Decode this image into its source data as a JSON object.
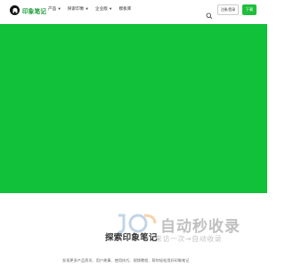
{
  "brand": {
    "name": "印象笔记"
  },
  "nav": {
    "items": [
      {
        "label": "产品",
        "dropdown": true
      },
      {
        "label": "探索印象",
        "dropdown": true
      },
      {
        "label": "企业版",
        "dropdown": true
      },
      {
        "label": "模板库",
        "dropdown": false
      }
    ]
  },
  "header": {
    "search_icon": "search-icon",
    "signup_label": "注册/登录",
    "download_label": "下载"
  },
  "hero": {
    "background": "#12c13a"
  },
  "section": {
    "title": "探索印象笔记",
    "description": "发现更多产品资讯、用户故事、使用技巧、视频教程、帮你轻松用好印象笔记"
  },
  "watermark": {
    "title": "自动秒收录",
    "subtitle": "来访一次→自动收录"
  },
  "colors": {
    "accent": "#1fbf3b",
    "brand_text": "#1f9e3a"
  }
}
